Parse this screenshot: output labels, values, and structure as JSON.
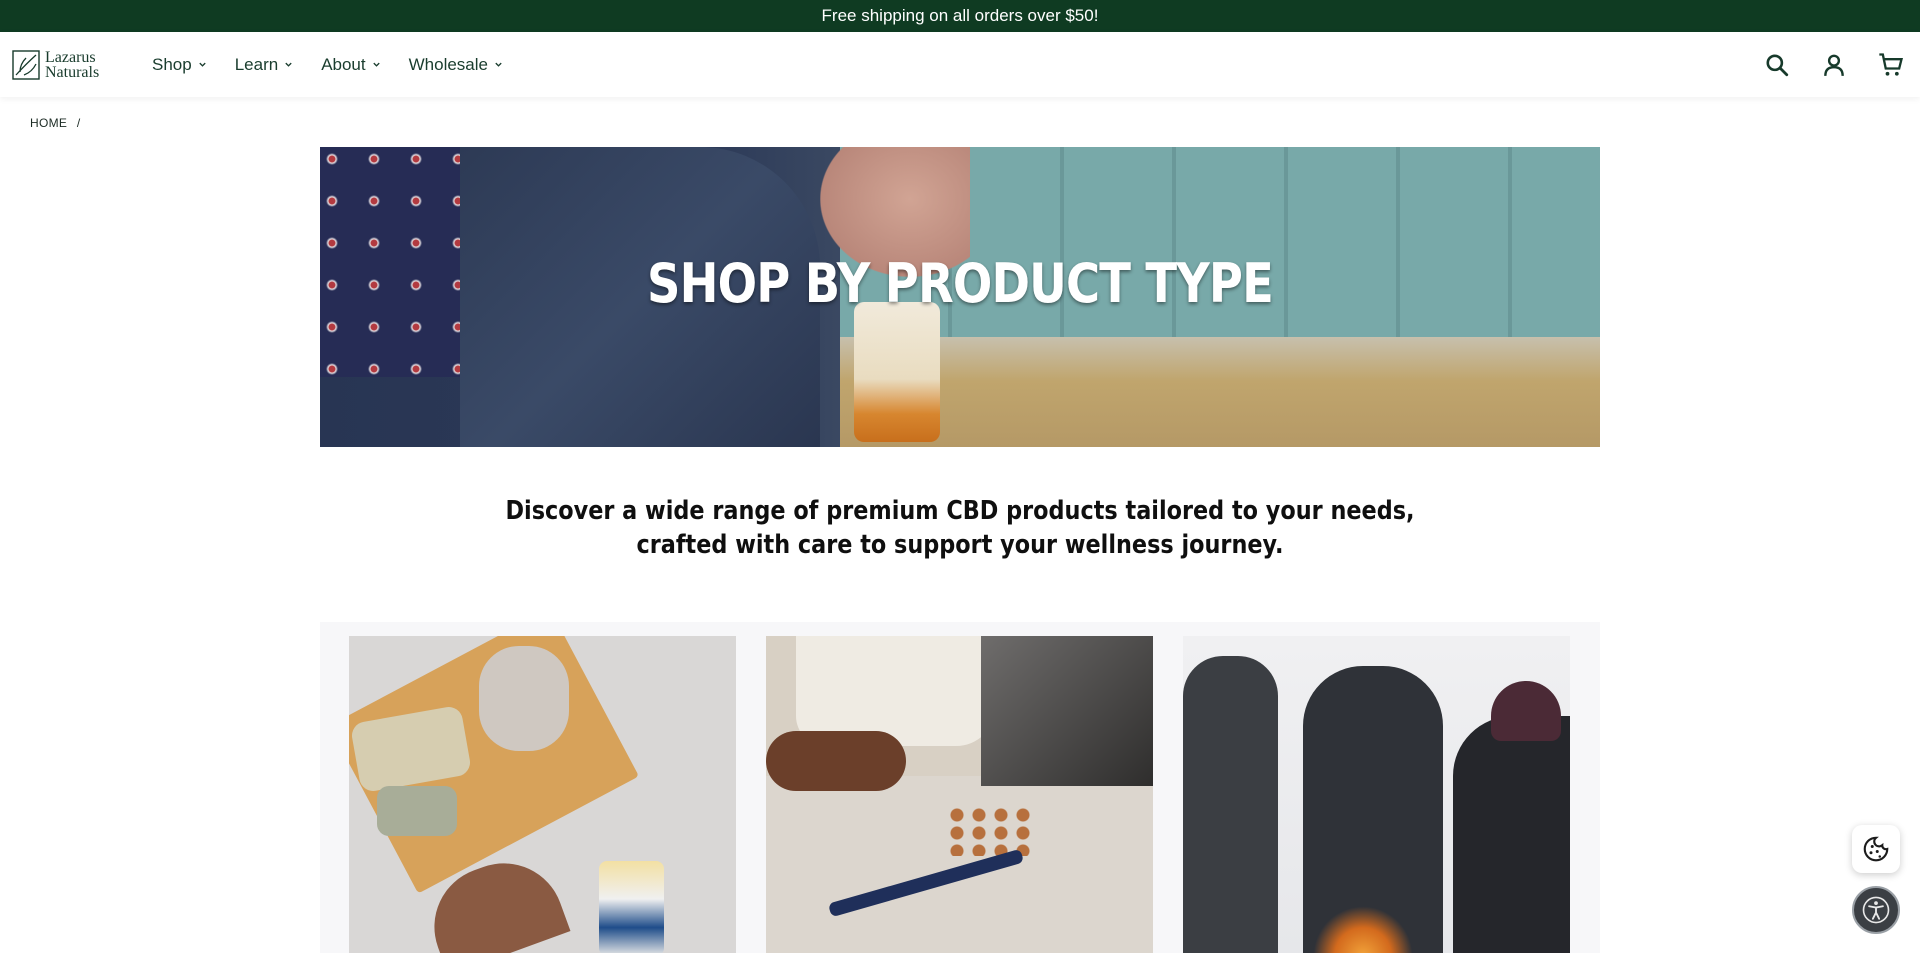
{
  "announcement": {
    "text": "Free shipping on all orders over $50!"
  },
  "header": {
    "logo_line1": "Lazarus",
    "logo_line2": "Naturals",
    "nav": [
      {
        "label": "Shop"
      },
      {
        "label": "Learn"
      },
      {
        "label": "About"
      },
      {
        "label": "Wholesale"
      }
    ],
    "icons": [
      "search-icon",
      "account-icon",
      "cart-icon"
    ]
  },
  "breadcrumb": {
    "home": "HOME",
    "separator": "/"
  },
  "hero": {
    "title": "SHOP BY PRODUCT TYPE"
  },
  "intro": {
    "line1": "Discover a wide range of premium CBD products tailored to your needs,",
    "line2": "crafted with care to support your wellness journey."
  },
  "colors": {
    "announcement_bg": "#0f3b22",
    "brand_text": "#1a3d2e",
    "section_bg": "#f7f7f9"
  },
  "floating": {
    "icons": [
      "cookie-icon",
      "accessibility-icon"
    ]
  }
}
